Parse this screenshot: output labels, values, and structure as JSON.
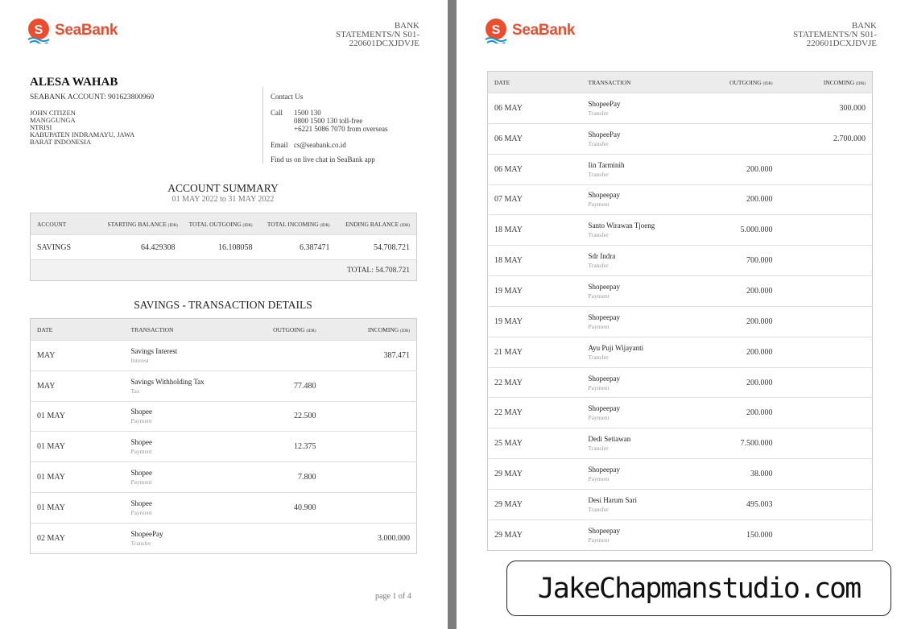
{
  "brand": {
    "name": "SeaBank",
    "color": "#ee4d2d",
    "logo_icon": "seabank-logo-icon"
  },
  "statement_ref": {
    "line1": "BANK",
    "line2": "STATEMENTS/N  S01-",
    "line3": "220601DCXJDVJE"
  },
  "holder": {
    "name": "ALESA WAHAB",
    "account_line": "SEABANK ACCOUNT: 901623800960",
    "address": "JOHN CITIZEN\nMANGGUNGA\nNTRISI\nKABUPATEN INDRAMAYU, JAWA\nBARAT INDONESIA"
  },
  "contact": {
    "title": "Contact Us",
    "call_label": "Call",
    "call_lines": [
      "1500 130",
      "0800 1500 130 toll-free",
      "+6221 5086 7070 from overseas"
    ],
    "email_label": "Email",
    "email": "cs@seabank.co.id",
    "footer": "Find us on live chat in SeaBank app"
  },
  "summary": {
    "title": "ACCOUNT SUMMARY",
    "period": "01 MAY 2022 to 31 MAY 2022",
    "headers": {
      "account": "ACCOUNT",
      "starting": "STARTING BALANCE",
      "outgoing": "TOTAL OUTGOING",
      "incoming": "TOTAL INCOMING",
      "ending": "ENDING BALANCE",
      "unit": "(IDR)"
    },
    "row": {
      "account": "SAVINGS",
      "starting": "64.429308",
      "outgoing": "16.108058",
      "incoming": "6.387471",
      "ending": "54.708.721"
    },
    "total": "TOTAL: 54.708.721"
  },
  "details": {
    "title": "SAVINGS - TRANSACTION DETAILS",
    "headers": {
      "date": "DATE",
      "transaction": "TRANSACTION",
      "outgoing": "OUTGOING",
      "incoming": "INCOMING",
      "unit": "(IDR)"
    }
  },
  "page1_rows": [
    {
      "date": "MAY",
      "desc": "Savings  Interest",
      "type": "Interest",
      "out": "",
      "in": "387.471"
    },
    {
      "date": "MAY",
      "desc": "Savings Withholding Tax",
      "type": "Tax",
      "out": "77.480",
      "in": ""
    },
    {
      "date": "01 MAY",
      "desc": "Shopee",
      "type": "Payment",
      "out": "22.500",
      "in": ""
    },
    {
      "date": "01 MAY",
      "desc": "Shopee",
      "type": "Payment",
      "out": "12.375",
      "in": ""
    },
    {
      "date": "01 MAY",
      "desc": "Shopee",
      "type": "Payment",
      "out": "7.800",
      "in": ""
    },
    {
      "date": "01 MAY",
      "desc": "Shopee",
      "type": "Payment",
      "out": "40.900",
      "in": ""
    },
    {
      "date": "02 MAY",
      "desc": "ShopeePay",
      "type": "Transfer",
      "out": "",
      "in": "3.000.000"
    }
  ],
  "page2_rows": [
    {
      "date": "06 MAY",
      "desc": "ShopeePay",
      "type": "Transfer",
      "out": "",
      "in": "300.000"
    },
    {
      "date": "06 MAY",
      "desc": "ShopeePay",
      "type": "Transfer",
      "out": "",
      "in": "2.700.000"
    },
    {
      "date": "06 MAY",
      "desc": "Iin Tarminih",
      "type": "Transfer",
      "out": "200.000",
      "in": ""
    },
    {
      "date": "07 MAY",
      "desc": "Shopeepay",
      "type": "Payment",
      "out": "200.000",
      "in": ""
    },
    {
      "date": "18 MAY",
      "desc": "Santo Wirawan Tjoeng",
      "type": "Transfer",
      "out": "5.000.000",
      "in": ""
    },
    {
      "date": "18 MAY",
      "desc": "Sdr Indra",
      "type": "Transfer",
      "out": "700.000",
      "in": ""
    },
    {
      "date": "19 MAY",
      "desc": "Shopeepay",
      "type": "Payment",
      "out": "200.000",
      "in": ""
    },
    {
      "date": "19 MAY",
      "desc": "Shopeepay",
      "type": "Payment",
      "out": "200.000",
      "in": ""
    },
    {
      "date": "21 MAY",
      "desc": "Ayu Puji Wijayanti",
      "type": "Transfer",
      "out": "200.000",
      "in": ""
    },
    {
      "date": "22 MAY",
      "desc": "Shopeepay",
      "type": "Payment",
      "out": "200.000",
      "in": ""
    },
    {
      "date": "22 MAY",
      "desc": "Shopeepay",
      "type": "Payment",
      "out": "200.000",
      "in": ""
    },
    {
      "date": "25 MAY",
      "desc": "Dedi Setiawan",
      "type": "Transfer",
      "out": "7.500.000",
      "in": ""
    },
    {
      "date": "29 MAY",
      "desc": "Shopeepay",
      "type": "Payment",
      "out": "38.000",
      "in": ""
    },
    {
      "date": "29 MAY",
      "desc": "Desi Harum Sari",
      "type": "Transfer",
      "out": "495.003",
      "in": ""
    },
    {
      "date": "29 MAY",
      "desc": "Shopeepay",
      "type": "Payment",
      "out": "150.000",
      "in": ""
    }
  ],
  "page_number": "page 1 of 4",
  "watermark": "JakeChapmanstudio.com"
}
